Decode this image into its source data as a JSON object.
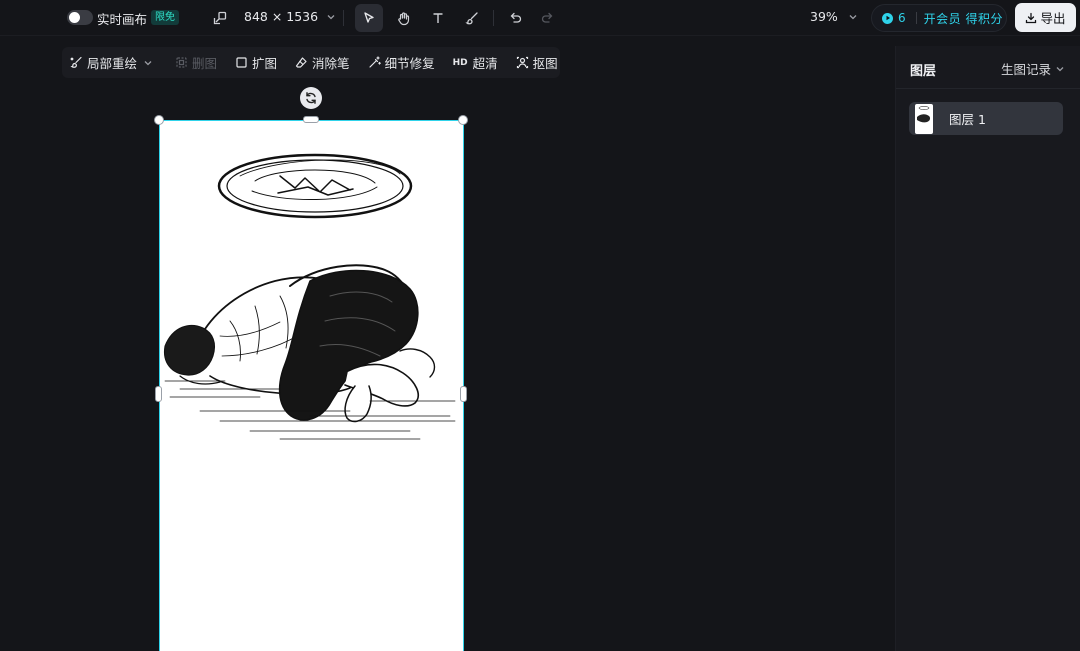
{
  "topbar": {
    "realtime_label": "实时画布",
    "realtime_badge": "限免",
    "dimensions": "848 × 1536",
    "zoom": "39%",
    "points_count": "6",
    "vip_text": "开会员 得积分",
    "export_label": "导出"
  },
  "canvas_toolbar": {
    "inpaint": "局部重绘",
    "cutout_disabled": "删图",
    "expand": "扩图",
    "eraser": "消除笔",
    "detail_fix": "细节修复",
    "hd_tag": "HD",
    "upscale": "超清",
    "matting": "抠图"
  },
  "right_panel": {
    "title": "图层",
    "history": "生图记录",
    "layers": [
      {
        "name": "图层 1"
      }
    ]
  },
  "colors": {
    "accent": "#2fd3ea",
    "background": "#141519",
    "panel": "#18191e"
  }
}
